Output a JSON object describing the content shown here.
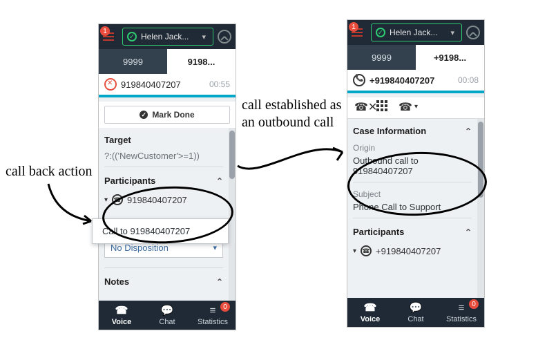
{
  "left": {
    "badge": "1",
    "agent_name": "Helen Jack...",
    "tabs": {
      "a": "9999",
      "b": "9198..."
    },
    "call_number": "919840407207",
    "timer": "00:55",
    "mark_done": "Mark Done",
    "section_target": "Target",
    "target_value": "?:(('NewCustomer'>=1))",
    "section_participants": "Participants",
    "participant_number": "919840407207",
    "popup_text": "Call to 919840407207",
    "disposition": "No Disposition",
    "section_notes": "Notes"
  },
  "right": {
    "badge": "1",
    "agent_name": "Helen Jack...",
    "tabs": {
      "a": "9999",
      "b": "+9198..."
    },
    "call_number": "+919840407207",
    "timer": "00:08",
    "section_case": "Case Information",
    "lbl_origin": "Origin",
    "origin_value": "Outbound call to 919840407207",
    "lbl_subject": "Subject",
    "subject_value": "Phone Call to Support",
    "section_participants": "Participants",
    "participant_number": "+919840407207"
  },
  "bottombar": {
    "voice": "Voice",
    "chat": "Chat",
    "statistics": "Statistics",
    "stats_badge": "0"
  },
  "annotations": {
    "callback": "call back action",
    "established_l1": "call established as",
    "established_l2": "an outbound call"
  }
}
